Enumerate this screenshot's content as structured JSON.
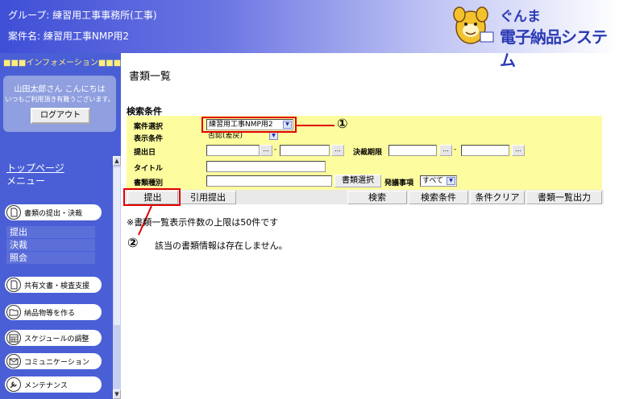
{
  "header": {
    "group_label": "グループ: ",
    "group_name": "練習用工事事務所(工事)",
    "case_label": "案件名: ",
    "case_name": "練習用工事NMP用2",
    "logo_line1": "ぐんま",
    "logo_line2": "電子納品システム"
  },
  "sidebar": {
    "info_bar": "■■■インフォメーション■■■",
    "user_name": "山田太郎さん こんにちは",
    "user_greeting": "いつもご利用頂き有難うございます。",
    "logout_label": "ログアウト",
    "top_page_link": "トップページ",
    "menu_label": "メニュー",
    "menu": {
      "submit": "書類の提出・決裁",
      "sub_submit": "提出",
      "sub_approve": "決裁",
      "sub_view": "照会",
      "shared": "共有文書・検査支援",
      "deliverables": "納品物等を作る",
      "schedule": "スケジュールの調整",
      "communication": "コミュニケーション",
      "maintenance": "メンテナンス"
    }
  },
  "main": {
    "title": "書類一覧",
    "search_heading": "検索条件",
    "fields": {
      "case_select_label": "案件選択",
      "case_select_value": "練習用工事NMP用2",
      "display_label": "表示条件",
      "display_value": "否認(差戻)",
      "submit_date_label": "提出日",
      "deadline_label": "決裁期限",
      "title_label": "タイトル",
      "doc_type_label": "書類種別",
      "doc_select_button": "書類選択",
      "issue_label": "発議事項",
      "issue_value": "すべて",
      "dot_button": "..."
    },
    "buttons": {
      "submit": "提出",
      "cite_submit": "引用提出",
      "search": "検索",
      "search_conditions": "検索条件",
      "clear_conditions": "条件クリア",
      "output_list": "書類一覧出力"
    },
    "note": "※書類一覧表示件数の上限は50件です",
    "message": "該当の書類情報は存在しません。",
    "callout_1": "①",
    "callout_2": "②"
  },
  "colors": {
    "header_start": "#3f4fd6",
    "sidebar_bg": "#4a5fd6",
    "form_bg": "#fdfd9f",
    "highlight": "#e00000"
  }
}
